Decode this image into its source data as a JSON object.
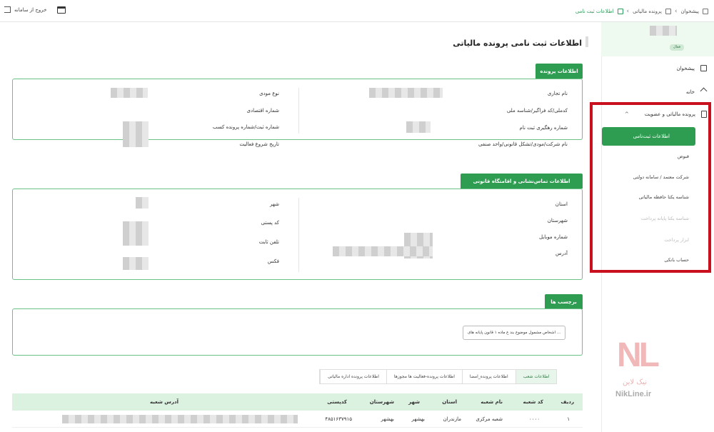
{
  "topbar": {
    "breadcrumb": [
      "پیشخوان",
      "پرونده مالیاتی",
      "اطلاعات ثبت نامی"
    ],
    "logout_label": "خروج از سامانه"
  },
  "sidebar": {
    "status": "فعال",
    "items": [
      {
        "label": "پیشخوان",
        "icon": "dashboard-icon"
      },
      {
        "label": "خانه",
        "icon": "home-icon"
      },
      {
        "label": "پرونده مالیاتی و عضویت",
        "icon": "document-icon"
      }
    ],
    "subitems": [
      {
        "label": "اطلاعات ثبت‌نامی",
        "state": "active"
      },
      {
        "label": "قبوض",
        "state": "normal"
      },
      {
        "label": "شرکت معتمد / سامانه دولتی",
        "state": "normal"
      },
      {
        "label": "شناسه یکتا حافظه مالیاتی",
        "state": "normal"
      },
      {
        "label": "شناسه یکتا پایانه پرداخت",
        "state": "disabled"
      },
      {
        "label": "ابزار پرداخت",
        "state": "disabled"
      },
      {
        "label": "حساب بانکی",
        "state": "normal"
      }
    ]
  },
  "page": {
    "title": "اطلاعات ثبت نامی پرونده مالیاتی"
  },
  "sections": {
    "file_info": {
      "title": "اطلاعات پرونده",
      "right_labels": [
        "نام تجاری",
        "کدملی/کد فراگیر/شناسه ملی",
        "شماره رهگیری ثبت نام",
        "نام شرکت/مودی/تشکل قانونی/واحد صنفی"
      ],
      "left_labels": [
        "نوع مودی",
        "شماره اقتصادی",
        "شماره ثبت/شماره پرونده کسب",
        "تاریخ شروع فعالیت"
      ]
    },
    "contact": {
      "title": "اطلاعات تماس‌نشانی و اقامتگاه قانونی",
      "right_labels": [
        "استان",
        "شهرستان",
        "شماره موبایل",
        "آدرس"
      ],
      "left_labels": [
        "شهر",
        "کد پستی",
        "تلفن ثابت",
        "فکس"
      ]
    },
    "tags": {
      "title": "برچسب ها",
      "pill": "اشخاص مشمول موضوع بند ع ماده ۱ قانون پایانه های ..."
    }
  },
  "tabs": [
    {
      "label": "اطلاعات شعب",
      "active": true
    },
    {
      "label": "اطلاعات پرونده_امضا",
      "active": false
    },
    {
      "label": "اطلاعات پرونده-فعالیت ها مجوزها",
      "active": false
    },
    {
      "label": "اطلاعات پرونده اداره مالیاتی",
      "active": false
    }
  ],
  "table": {
    "headers": [
      "ردیف",
      "کد شعبه",
      "نام شعبه",
      "استان",
      "شهر",
      "شهرستان",
      "کدپستی",
      "آدرس شعبه"
    ],
    "rows": [
      [
        "۱",
        "۰۰۰۰",
        "شعبه مرکزی",
        "مازندران",
        "بهشهر",
        "بهشهر",
        "۴۸۵۱۶۳۷۹۱۵",
        ""
      ]
    ]
  },
  "watermark": {
    "logo": "NL",
    "fa": "نیک لاین",
    "en": "NikLine.ir"
  }
}
